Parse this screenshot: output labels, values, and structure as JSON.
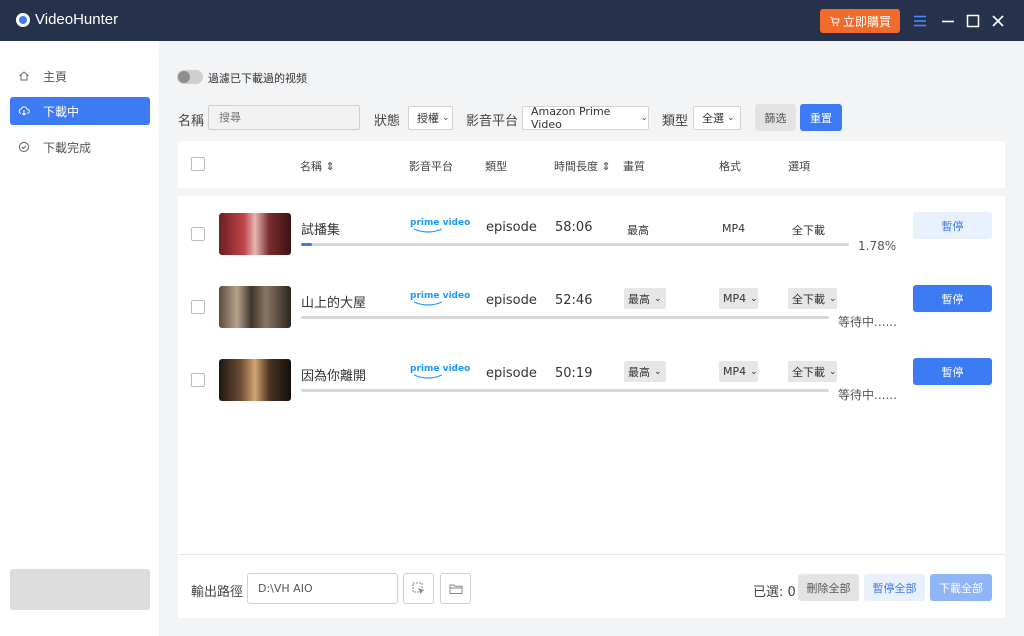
{
  "app": {
    "title": "VideoHunter",
    "buy_label": "立即購買"
  },
  "sidebar": {
    "items": [
      {
        "label": "主頁",
        "icon": "home-icon"
      },
      {
        "label": "下載中",
        "icon": "download-cloud-icon",
        "active": true
      },
      {
        "label": "下載完成",
        "icon": "check-circle-icon"
      }
    ]
  },
  "filters": {
    "toggle_label": "過濾已下載過的视频",
    "name_label": "名稱",
    "search_placeholder": "搜尋",
    "status_label": "狀態",
    "status_value": "授權",
    "platform_label": "影音平台",
    "platform_value": "Amazon Prime Video",
    "type_label": "類型",
    "type_value": "全選",
    "filter_button": "篩选",
    "reset_button": "重置"
  },
  "table": {
    "headers": {
      "name": "名稱",
      "platform": "影音平台",
      "type": "類型",
      "duration": "時間長度",
      "quality": "畫質",
      "format": "格式",
      "options": "選項"
    },
    "rows": [
      {
        "title": "試播集",
        "platform_logo": "prime video",
        "type": "episode",
        "duration": "58:06",
        "quality": "最高",
        "format": "MP4",
        "option": "全下載",
        "status": "1.78%",
        "progress": 0.0178,
        "action": "暫停"
      },
      {
        "title": "山上的大屋",
        "platform_logo": "prime video",
        "type": "episode",
        "duration": "52:46",
        "quality": "最高",
        "format": "MP4",
        "option": "全下載",
        "status": "等待中......",
        "progress": 0,
        "action": "暫停"
      },
      {
        "title": "因為你離開",
        "platform_logo": "prime video",
        "type": "episode",
        "duration": "50:19",
        "quality": "最高",
        "format": "MP4",
        "option": "全下載",
        "status": "等待中......",
        "progress": 0,
        "action": "暫停"
      }
    ]
  },
  "footer": {
    "output_label": "輸出路徑",
    "output_path": "D:\\VH AIO",
    "selected_label": "已選: 0",
    "delete_all": "刪除全部",
    "pause_all": "暫停全部",
    "download_all": "下載全部"
  },
  "colors": {
    "titlebar": "#26324b",
    "accent": "#3d7bf5",
    "buy": "#f26b2a",
    "prime": "#1a98ff"
  }
}
